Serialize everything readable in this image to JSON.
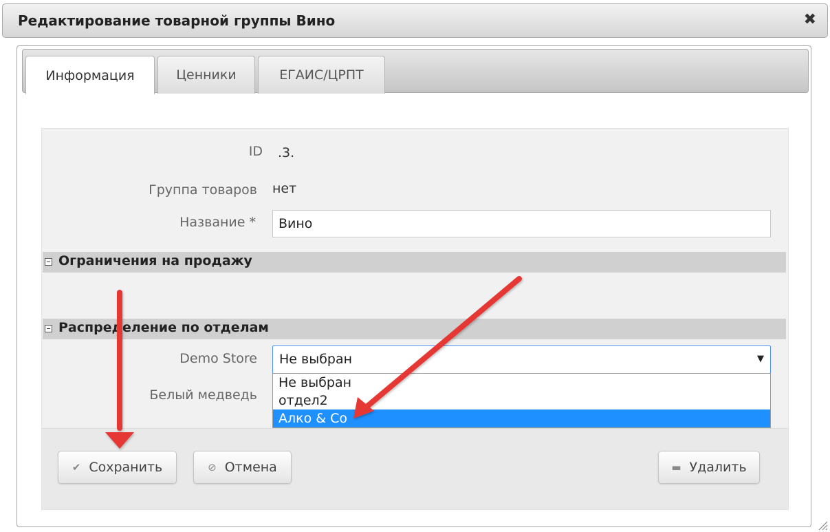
{
  "dialog": {
    "title": "Редактирование товарной группы Вино",
    "close_glyph": "✖"
  },
  "tabs": [
    {
      "label": "Информация",
      "active": true
    },
    {
      "label": "Ценники",
      "active": false
    },
    {
      "label": "ЕГАИС/ЦРПТ",
      "active": false
    }
  ],
  "form": {
    "id_label": "ID",
    "id_value": ".3.",
    "group_label": "Группа товаров",
    "group_value": "нет",
    "name_label": "Название *",
    "name_value": "Вино"
  },
  "sections": {
    "sales_restrictions": "Ограничения на продажу",
    "department_distribution": "Распределение по отделам"
  },
  "departments": {
    "demo_store_label": "Demo Store",
    "demo_store_selected": "Не выбран",
    "white_bear_label": "Белый медведь",
    "dropdown_options": [
      "Не выбран",
      "отдел2",
      "Алко & Co"
    ],
    "highlighted_option": "Алко & Co"
  },
  "buttons": {
    "save": "Сохранить",
    "cancel": "Отмена",
    "delete": "Удалить"
  },
  "icons": {
    "save": "check-icon",
    "cancel": "ban-icon",
    "delete": "minus-icon",
    "close": "close-icon"
  },
  "colors": {
    "highlight": "#1e90ff",
    "select_border": "#4d90fe",
    "annotation_arrow": "#e53935"
  }
}
